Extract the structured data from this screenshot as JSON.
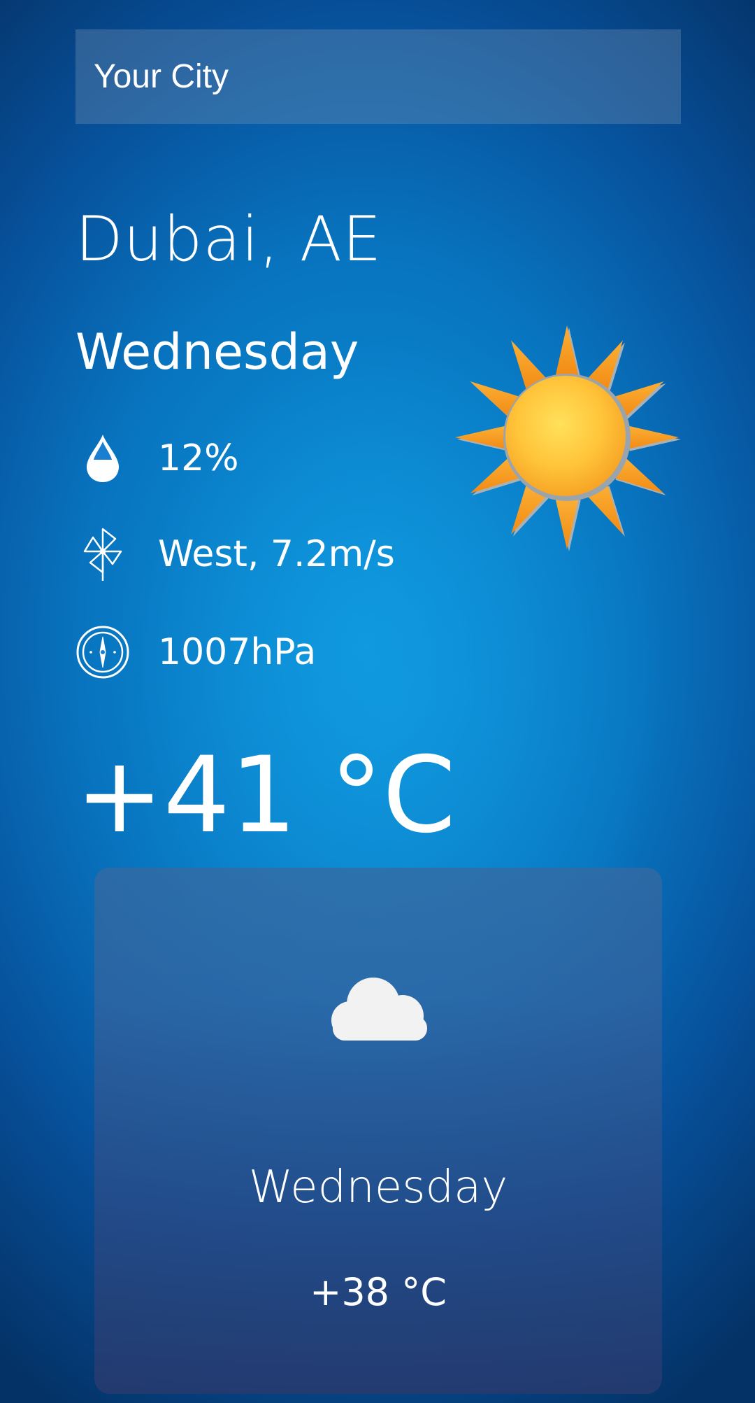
{
  "search": {
    "placeholder": "Your City"
  },
  "current": {
    "city": "Dubai, AE",
    "day": "Wednesday",
    "humidity": "12%",
    "wind": "West, 7.2m/s",
    "pressure": "1007hPa",
    "temperature": "+41 °C",
    "condition_icon": "sun-icon"
  },
  "icons": {
    "humidity": "water-drop-icon",
    "wind": "pinwheel-icon",
    "pressure": "barometer-icon"
  },
  "forecast": [
    {
      "day": "Wednesday",
      "temperature": "+38 °C",
      "icon": "cloud-icon"
    }
  ],
  "colors": {
    "background_top": "#043266",
    "background_center": "#0c94da",
    "sun_core": "#ffc43a",
    "sun_rays": "#f7941d",
    "card": "#2f5e9a"
  }
}
